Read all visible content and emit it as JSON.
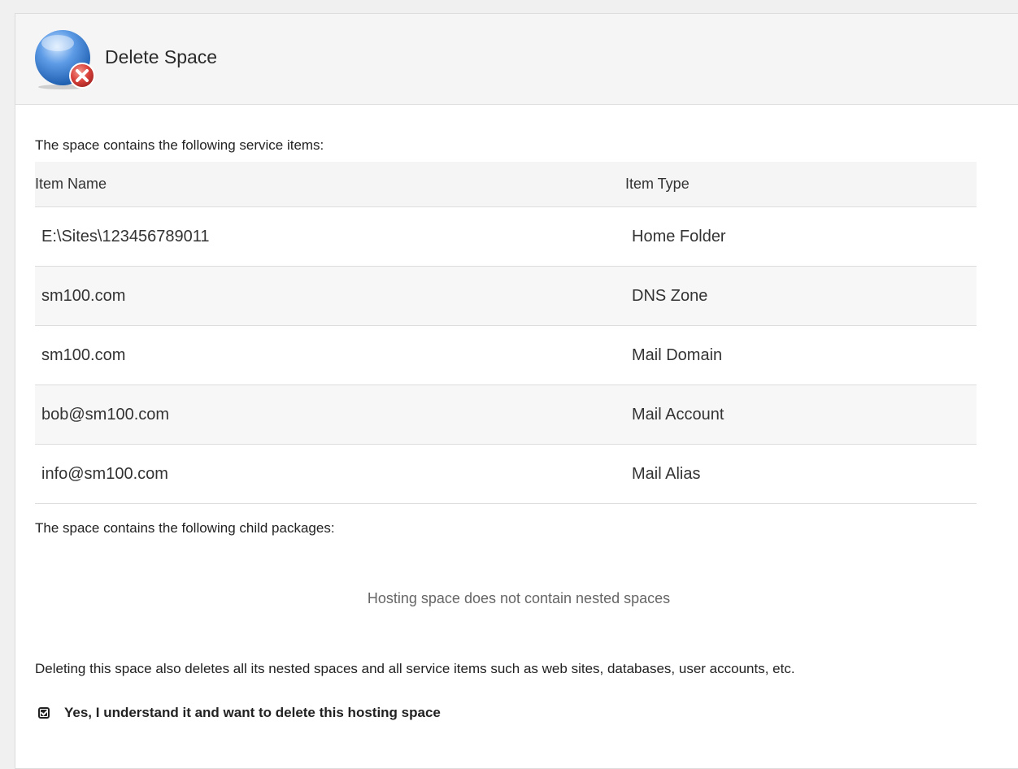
{
  "header": {
    "title": "Delete Space",
    "icon": "delete-space-icon"
  },
  "items_section": {
    "label": "The space contains the following service items:",
    "columns": [
      "Item Name",
      "Item Type"
    ],
    "rows": [
      {
        "name": "E:\\Sites\\123456789011",
        "type": "Home Folder"
      },
      {
        "name": "sm100.com",
        "type": "DNS Zone"
      },
      {
        "name": "sm100.com",
        "type": "Mail Domain"
      },
      {
        "name": "bob@sm100.com",
        "type": "Mail Account"
      },
      {
        "name": "info@sm100.com",
        "type": "Mail Alias"
      }
    ]
  },
  "child_section": {
    "label": "The space contains the following child packages:",
    "empty_text": "Hosting space does not contain nested spaces"
  },
  "warning_text": "Deleting this space also deletes all its nested spaces and all service items such as web sites, databases, user accounts, etc.",
  "confirm": {
    "label": "Yes, I understand it and want to delete this hosting space",
    "checked": true
  },
  "colors": {
    "header_bg": "#f5f5f5",
    "row_alt_bg": "#f7f7f7",
    "icon_blue": "#3a7bd5",
    "icon_red": "#d9413a"
  }
}
